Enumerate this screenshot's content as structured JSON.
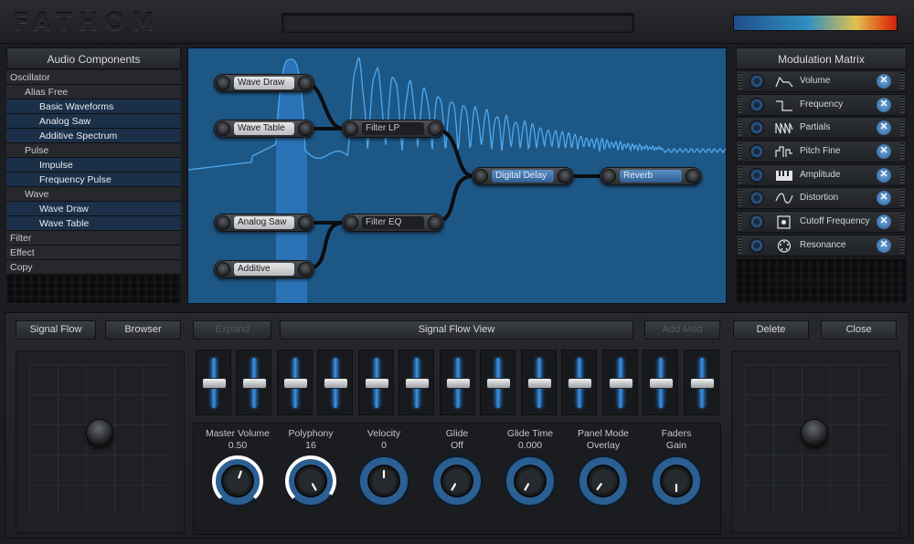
{
  "app": {
    "logo_text": "FATHOM",
    "meter_colors": [
      "#1f4f8c",
      "#e0c050",
      "#d02010"
    ]
  },
  "audio_components": {
    "title": "Audio Components",
    "items": [
      {
        "label": "Oscillator",
        "level": 0
      },
      {
        "label": "Alias Free",
        "level": 1
      },
      {
        "label": "Basic Waveforms",
        "level": 2
      },
      {
        "label": "Analog Saw",
        "level": 2
      },
      {
        "label": "Additive Spectrum",
        "level": 2
      },
      {
        "label": "Pulse",
        "level": 1
      },
      {
        "label": "Impulse",
        "level": 2
      },
      {
        "label": "Frequency Pulse",
        "level": 2
      },
      {
        "label": "Wave",
        "level": 1
      },
      {
        "label": "Wave Draw",
        "level": 2
      },
      {
        "label": "Wave Table",
        "level": 2
      },
      {
        "label": "Filter",
        "level": 0
      },
      {
        "label": "Effect",
        "level": 0
      },
      {
        "label": "Copy",
        "level": 0
      }
    ]
  },
  "signal_flow": {
    "nodes": [
      {
        "id": "wave_draw",
        "label": "Wave Draw",
        "style": "light"
      },
      {
        "id": "wave_table",
        "label": "Wave Table",
        "style": "light"
      },
      {
        "id": "filter_lp",
        "label": "Filter LP",
        "style": "dark"
      },
      {
        "id": "analog_saw",
        "label": "Analog Saw",
        "style": "light"
      },
      {
        "id": "filter_eq",
        "label": "Filter EQ",
        "style": "dark"
      },
      {
        "id": "additive",
        "label": "Additive",
        "style": "light"
      },
      {
        "id": "digital_delay",
        "label": "Digital Delay",
        "style": "blue"
      },
      {
        "id": "reverb",
        "label": "Reverb",
        "style": "blue"
      }
    ]
  },
  "modulation_matrix": {
    "title": "Modulation Matrix",
    "items": [
      {
        "label": "Volume",
        "icon": "envelope-icon"
      },
      {
        "label": "Frequency",
        "icon": "pulse-wave-icon"
      },
      {
        "label": "Partials",
        "icon": "partials-icon"
      },
      {
        "label": "Pitch Fine",
        "icon": "pitch-steps-icon"
      },
      {
        "label": "Amplitude",
        "icon": "keyboard-icon"
      },
      {
        "label": "Distortion",
        "icon": "sine-wave-icon"
      },
      {
        "label": "Cutoff Frequency",
        "icon": "cutoff-square-icon"
      },
      {
        "label": "Resonance",
        "icon": "resonance-dial-icon"
      }
    ],
    "remove_glyph": "✕"
  },
  "toolbar": {
    "signal_flow": "Signal Flow",
    "browser": "Browser",
    "expand": "Expand",
    "view_title": "Signal Flow View",
    "add_mod": "Add Mod",
    "delete": "Delete",
    "close": "Close"
  },
  "faders": {
    "count": 13,
    "level": 0.5
  },
  "knobs": [
    {
      "name": "Master Volume",
      "value": "0.50",
      "ring_fraction": 0.75,
      "pointer_deg": 20
    },
    {
      "name": "Polyphony",
      "value": "16",
      "ring_fraction": 0.72,
      "pointer_deg": 150
    },
    {
      "name": "Velocity",
      "value": "0",
      "ring_fraction": 0,
      "pointer_deg": 0
    },
    {
      "name": "Glide",
      "value": "Off",
      "ring_fraction": 0,
      "pointer_deg": -150
    },
    {
      "name": "Glide Time",
      "value": "0.000",
      "ring_fraction": 0,
      "pointer_deg": -150
    },
    {
      "name": "Panel Mode",
      "value": "Overlay",
      "ring_fraction": 0,
      "pointer_deg": -145
    },
    {
      "name": "Faders",
      "value": "Gain",
      "ring_fraction": 0,
      "pointer_deg": 180
    }
  ]
}
